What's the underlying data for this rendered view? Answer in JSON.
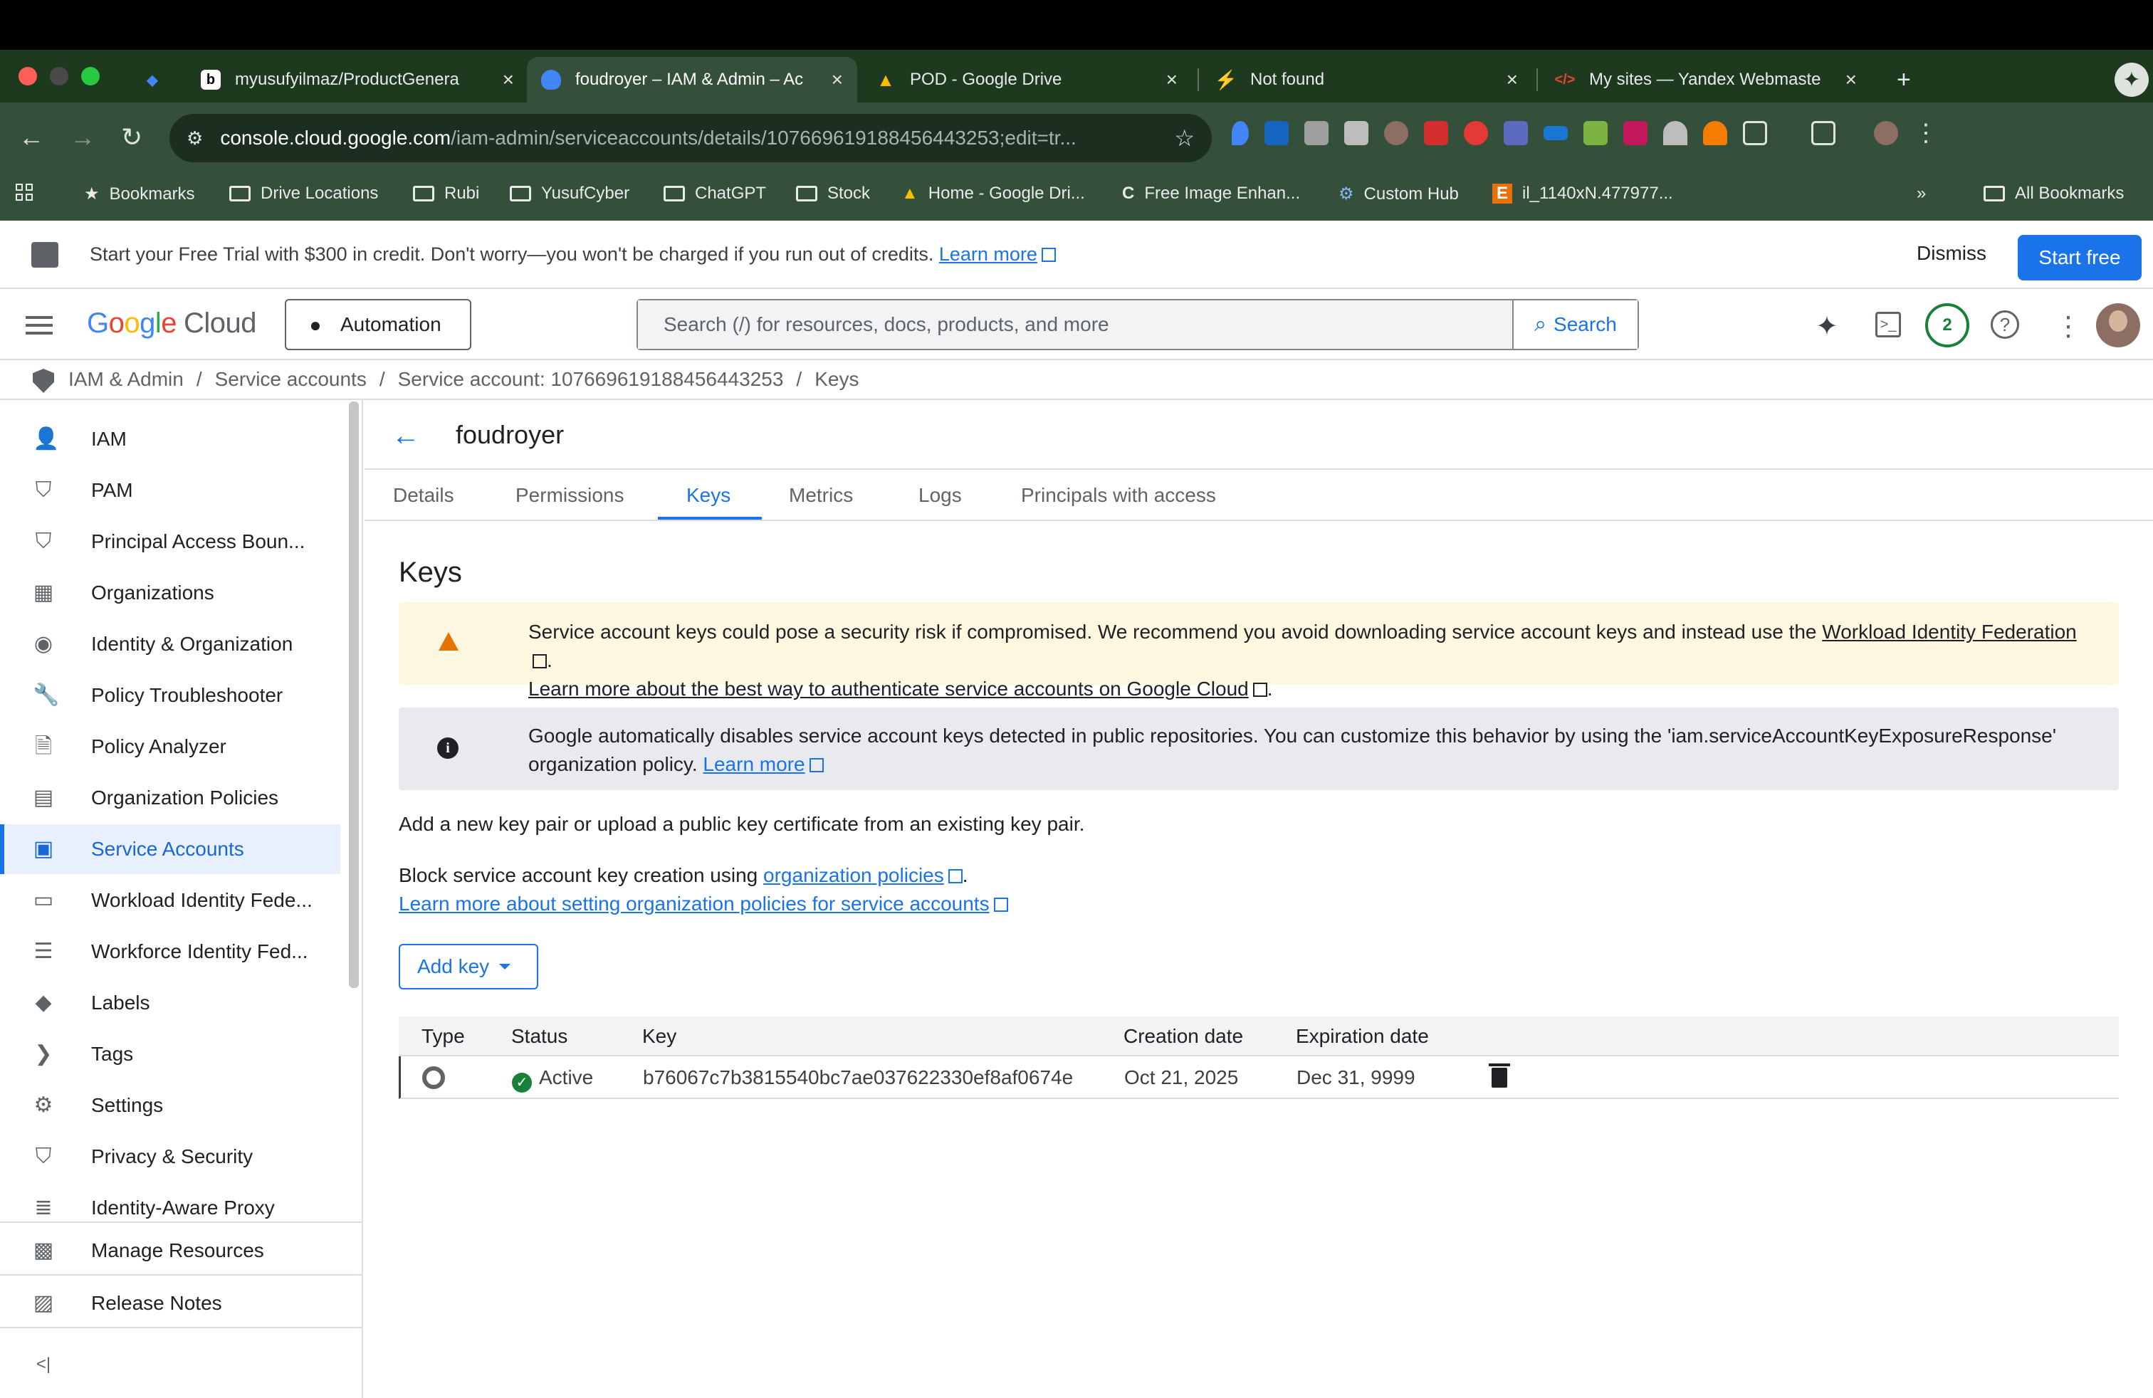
{
  "browser": {
    "tabs": [
      {
        "title": "myusufyilmaz/ProductGenera",
        "favicon": "b"
      },
      {
        "title": "foudroyer – IAM & Admin – Ac",
        "favicon": "shield"
      },
      {
        "title": "POD - Google Drive",
        "favicon": "drive"
      },
      {
        "title": "Not found",
        "favicon": "bolt"
      },
      {
        "title": "My sites — Yandex Webmaste",
        "favicon": "code"
      }
    ],
    "url_host": "console.cloud.google.com",
    "url_path": "/iam-admin/serviceaccounts/details/107669619188456443253;edit=tr...",
    "bookmarks": [
      "Bookmarks",
      "Drive Locations",
      "Rubi",
      "YusufCyber",
      "ChatGPT",
      "Stock",
      "Home - Google Dri...",
      "Free Image Enhan...",
      "Custom Hub",
      "il_1140xN.477977..."
    ],
    "all_bookmarks": "All Bookmarks",
    "more_bookmarks": "»"
  },
  "trial": {
    "message": "Start your Free Trial with $300 in credit. Don't worry—you won't be charged if you run out of credits.",
    "learn_more": "Learn more",
    "dismiss": "Dismiss",
    "start_free": "Start free"
  },
  "header": {
    "logo_google": "Google",
    "logo_cloud": "Cloud",
    "automation": "Automation",
    "search_placeholder": "Search (/) for resources, docs, products, and more",
    "search_button": "Search",
    "notif_count": "2"
  },
  "breadcrumb": {
    "items": [
      "IAM & Admin",
      "Service accounts",
      "Service account: 107669619188456443253",
      "Keys"
    ],
    "sep": "/"
  },
  "sidebar": {
    "items": [
      {
        "label": "IAM",
        "icon": "person-add-icon"
      },
      {
        "label": "PAM",
        "icon": "shield-icon"
      },
      {
        "label": "Principal Access Boun...",
        "icon": "boundary-icon"
      },
      {
        "label": "Organizations",
        "icon": "building-icon"
      },
      {
        "label": "Identity & Organization",
        "icon": "account-circle-icon"
      },
      {
        "label": "Policy Troubleshooter",
        "icon": "wrench-icon"
      },
      {
        "label": "Policy Analyzer",
        "icon": "document-search-icon"
      },
      {
        "label": "Organization Policies",
        "icon": "list-doc-icon"
      },
      {
        "label": "Service Accounts",
        "icon": "service-account-icon"
      },
      {
        "label": "Workload Identity Fede...",
        "icon": "id-card-icon"
      },
      {
        "label": "Workforce Identity Fed...",
        "icon": "list-icon"
      },
      {
        "label": "Labels",
        "icon": "tag-icon"
      },
      {
        "label": "Tags",
        "icon": "chevron-tag-icon"
      },
      {
        "label": "Settings",
        "icon": "gear-icon"
      },
      {
        "label": "Privacy & Security",
        "icon": "shield-icon"
      },
      {
        "label": "Identity-Aware Proxy",
        "icon": "proxy-icon"
      }
    ],
    "active_index": 8,
    "bottom": [
      {
        "label": "Manage Resources",
        "icon": "folder-gear-icon"
      },
      {
        "label": "Release Notes",
        "icon": "notes-icon"
      }
    ],
    "collapse_glyph": "<|"
  },
  "page": {
    "title": "foudroyer",
    "tabs": [
      "Details",
      "Permissions",
      "Keys",
      "Metrics",
      "Logs",
      "Principals with access"
    ],
    "active_tab": "Keys",
    "section_title": "Keys",
    "warning_text": "Service account keys could pose a security risk if compromised. We recommend you avoid downloading service account keys and instead use the ",
    "warning_link1": "Workload Identity Federation",
    "warning_period": ".",
    "warning_link2": "Learn more about the best way to authenticate service accounts on Google Cloud",
    "info_text": "Google automatically disables service account keys detected in public repositories. You can customize this behavior by using the 'iam.serviceAccountKeyExposureResponse' organization policy. ",
    "info_link": "Learn more",
    "add_text": "Add a new key pair or upload a public key certificate from an existing key pair.",
    "block_text": "Block service account key creation using ",
    "block_link": "organization policies",
    "block_period": ".",
    "learn_policies": "Learn more about setting organization policies for service accounts",
    "add_key": "Add key"
  },
  "table": {
    "columns": [
      "Type",
      "Status",
      "Key",
      "Creation date",
      "Expiration date"
    ],
    "rows": [
      {
        "type_icon": "gear-icon",
        "status": "Active",
        "key": "b76067c7b3815540bc7ae037622330ef8af0674e",
        "created": "Oct 21, 2025",
        "expires": "Dec 31, 9999"
      }
    ]
  }
}
